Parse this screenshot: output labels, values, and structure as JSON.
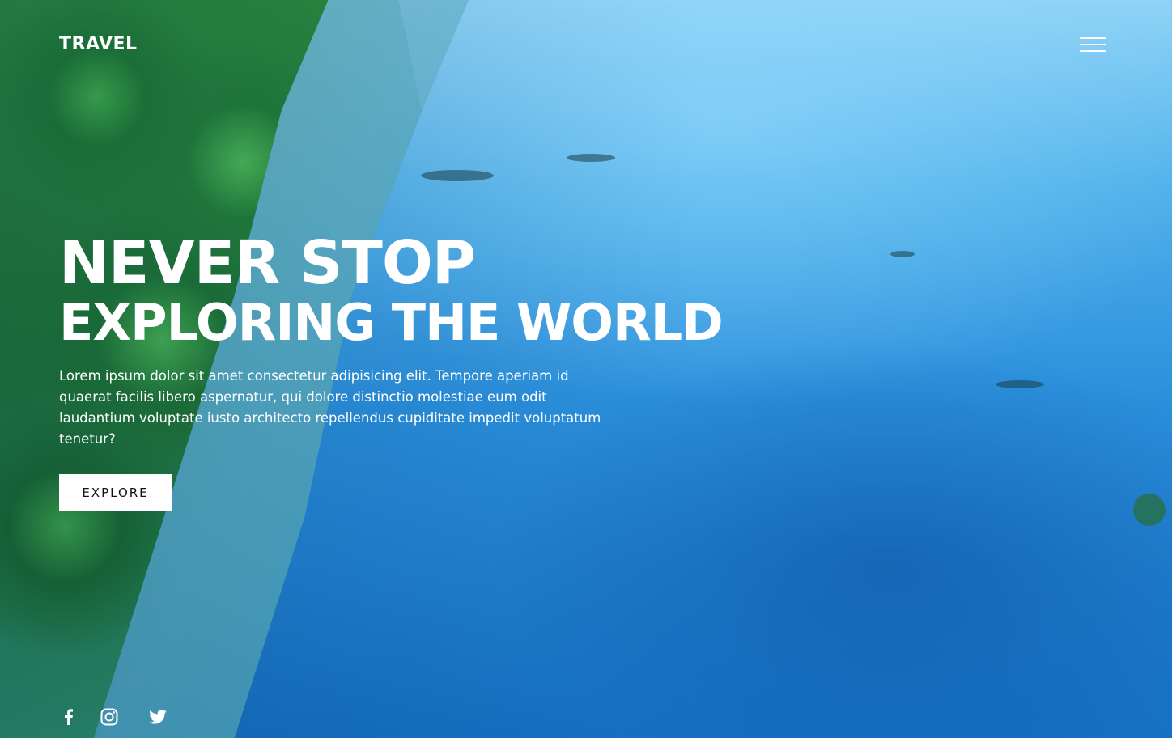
{
  "header": {
    "logo_text": "TRAVEL",
    "menu_icon": "hamburger-menu-icon"
  },
  "hero": {
    "title_line1": "NEVER STOP",
    "title_line2": "EXPLORING THE WORLD",
    "description": "Lorem ipsum dolor sit amet consectetur adipisicing elit. Tempore aperiam id quaerat facilis libero aspernatur, qui dolore distinctio molestiae eum odit laudantium voluptate iusto architecto repellendus cupiditate impedit voluptatum tenetur?",
    "cta_label": "EXPLORE"
  },
  "social": {
    "items": [
      {
        "icon": "facebook-icon"
      },
      {
        "icon": "instagram-icon"
      },
      {
        "icon": "twitter-icon"
      }
    ]
  },
  "colors": {
    "text": "#ffffff",
    "button_bg": "#ffffff",
    "button_text": "#111111",
    "water": "#1c7fd0",
    "forest": "#1f7535"
  }
}
